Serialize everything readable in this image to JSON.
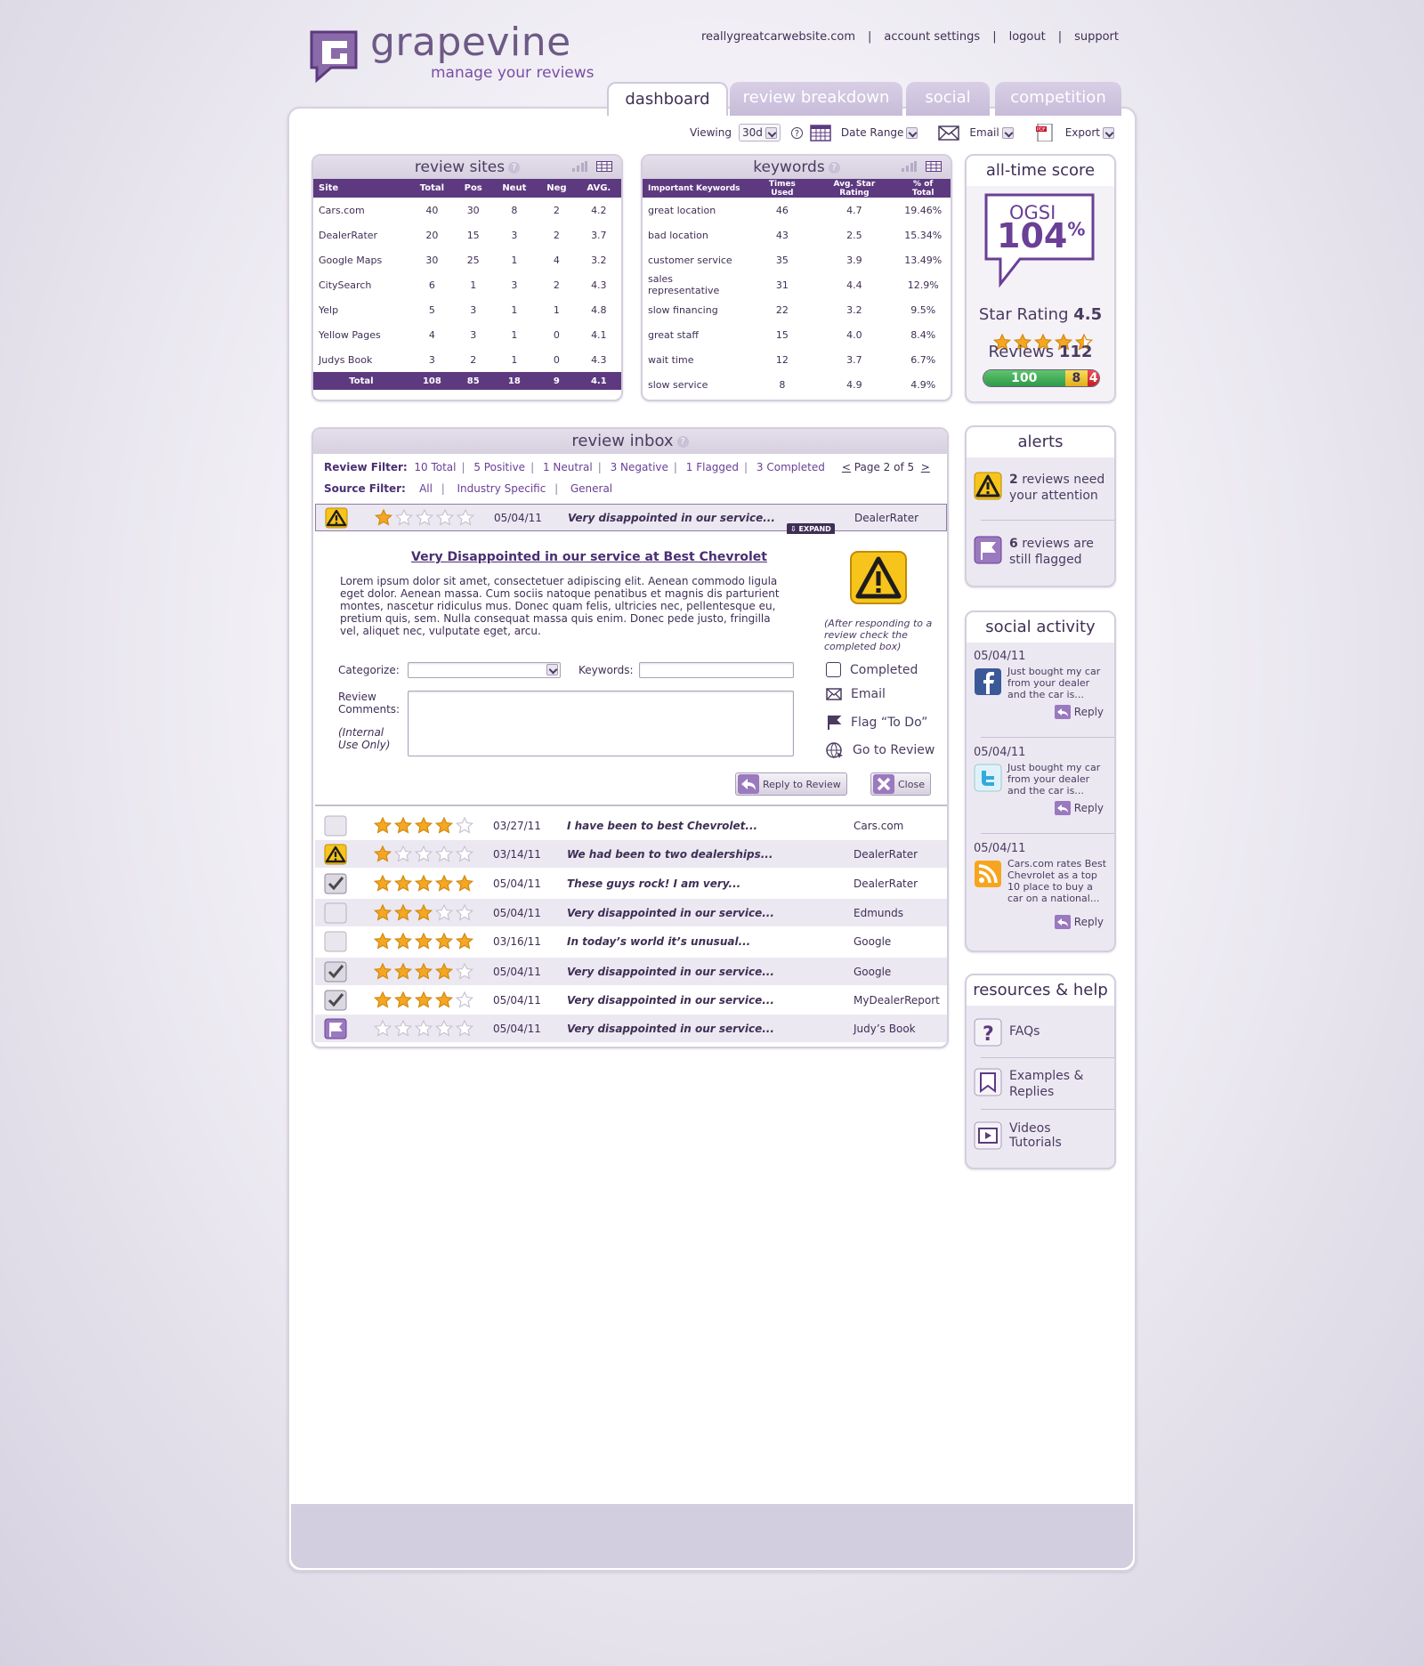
{
  "brand": {
    "name": "grapevine",
    "tagline": "manage your reviews"
  },
  "top_links": [
    "reallygreatcarwebsite.com",
    "account settings",
    "logout",
    "support"
  ],
  "tabs": [
    {
      "label": "dashboard",
      "active": true
    },
    {
      "label": "review breakdown",
      "active": false
    },
    {
      "label": "social",
      "active": false
    },
    {
      "label": "competition",
      "active": false
    }
  ],
  "toolbar": {
    "viewing_label": "Viewing",
    "viewing_value": "30d",
    "date_range": "Date Range",
    "email": "Email",
    "export": "Export"
  },
  "review_sites": {
    "title": "review sites",
    "columns": [
      "Site",
      "Total",
      "Pos",
      "Neut",
      "Neg",
      "AVG."
    ],
    "rows": [
      [
        "Cars.com",
        "40",
        "30",
        "8",
        "2",
        "4.2"
      ],
      [
        "DealerRater",
        "20",
        "15",
        "3",
        "2",
        "3.7"
      ],
      [
        "Google Maps",
        "30",
        "25",
        "1",
        "4",
        "3.2"
      ],
      [
        "CitySearch",
        "6",
        "1",
        "3",
        "2",
        "4.3"
      ],
      [
        "Yelp",
        "5",
        "3",
        "1",
        "1",
        "4.8"
      ],
      [
        "Yellow Pages",
        "4",
        "3",
        "1",
        "0",
        "4.1"
      ],
      [
        "Judys Book",
        "3",
        "2",
        "1",
        "0",
        "4.3"
      ]
    ],
    "total": [
      "Total",
      "108",
      "85",
      "18",
      "9",
      "4.1"
    ]
  },
  "keywords": {
    "title": "keywords",
    "columns": [
      "Important Keywords",
      "Times Used",
      "Avg. Star Rating",
      "% of Total"
    ],
    "rows": [
      [
        "great location",
        "46",
        "4.7",
        "19.46%"
      ],
      [
        "bad location",
        "43",
        "2.5",
        "15.34%"
      ],
      [
        "customer service",
        "35",
        "3.9",
        "13.49%"
      ],
      [
        "sales representative",
        "31",
        "4.4",
        "12.9%"
      ],
      [
        "slow financing",
        "22",
        "3.2",
        "9.5%"
      ],
      [
        "great staff",
        "15",
        "4.0",
        "8.4%"
      ],
      [
        "wait time",
        "12",
        "3.7",
        "6.7%"
      ],
      [
        "slow service",
        "8",
        "4.9",
        "4.9%"
      ]
    ]
  },
  "all_time_score": {
    "title": "all-time score",
    "ogsi_label": "OGSI",
    "ogsi_value": "104",
    "ogsi_unit": "%",
    "star_rating_label": "Star Rating",
    "star_rating_value": "4.5",
    "star_rating": 4.5,
    "reviews_label": "Reviews",
    "reviews_value": "112",
    "breakdown": [
      {
        "value": "100",
        "color": "#2f9a4a"
      },
      {
        "value": "8",
        "color": "#f0c419"
      },
      {
        "value": "4",
        "color": "#d4232a"
      }
    ]
  },
  "alerts": {
    "title": "alerts",
    "items": [
      {
        "count": "2",
        "text": "reviews need your attention"
      },
      {
        "count": "6",
        "text": "reviews are still flagged"
      }
    ]
  },
  "social_activity": {
    "title": "social activity",
    "reply_label": "Reply",
    "items": [
      {
        "date": "05/04/11",
        "icon": "facebook-icon",
        "text": "Just bought my car from your dealer and the car is..."
      },
      {
        "date": "05/04/11",
        "icon": "twitter-icon",
        "text": "Just bought my car from your dealer and the car is..."
      },
      {
        "date": "05/04/11",
        "icon": "rss-icon",
        "text": "Cars.com rates Best Chevrolet as a top 10 place to buy a car on a national..."
      }
    ]
  },
  "resources": {
    "title": "resources & help",
    "items": [
      "FAQs",
      "Examples & Replies",
      "Videos Tutorials"
    ]
  },
  "inbox": {
    "title": "review inbox",
    "review_filter_label": "Review Filter:",
    "review_filters": [
      "10 Total",
      "5 Positive",
      "1 Neutral",
      "3 Negative",
      "1 Flagged",
      "3 Completed"
    ],
    "pager_prev": "<",
    "pager_text": "Page 2 of 5",
    "pager_next": ">",
    "source_filter_label": "Source Filter:",
    "source_filters": [
      "All",
      "Industry Specific",
      "General"
    ],
    "expand_label": "EXPAND",
    "expanded": {
      "date": "05/04/11",
      "snippet": "Very disappointed in our service...",
      "source": "DealerRater",
      "stars": 1,
      "title": "Very Disappointed in our service at Best Chevrolet",
      "body": "Lorem ipsum dolor sit amet, consectetuer adipiscing elit. Aenean commodo ligula eget dolor. Aenean massa. Cum sociis natoque penatibus et magnis dis parturient montes, nascetur ridiculus mus. Donec quam felis, ultricies nec, pellentesque eu, pretium quis, sem. Nulla consequat massa quis enim. Donec pede justo, fringilla vel, aliquet nec, vulputate eget, arcu.",
      "note": "(After responding to a review check the completed box)",
      "categorize_label": "Categorize:",
      "keywords_label": "Keywords:",
      "comments_label": "Review Comments:",
      "internal_label": "(Internal Use Only)",
      "actions": [
        "Completed",
        "Email",
        "Flag “To Do”",
        "Go to Review"
      ],
      "reply_button": "Reply to Review",
      "close_button": "Close"
    },
    "rows": [
      {
        "status": "empty",
        "stars": 4,
        "date": "03/27/11",
        "snippet": "I have been to best Chevrolet...",
        "source": "Cars.com"
      },
      {
        "status": "warning",
        "stars": 1,
        "date": "03/14/11",
        "snippet": "We had been to two dealerships...",
        "source": "DealerRater"
      },
      {
        "status": "checked",
        "stars": 5,
        "date": "05/04/11",
        "snippet": "These guys rock! I am very...",
        "source": "DealerRater"
      },
      {
        "status": "empty",
        "stars": 3,
        "date": "05/04/11",
        "snippet": "Very disappointed in our service...",
        "source": "Edmunds"
      },
      {
        "status": "empty",
        "stars": 5,
        "date": "03/16/11",
        "snippet": "In today’s world it’s unusual...",
        "source": "Google"
      },
      {
        "status": "checked",
        "stars": 4,
        "date": "05/04/11",
        "snippet": "Very disappointed in our service...",
        "source": "Google"
      },
      {
        "status": "checked",
        "stars": 4,
        "date": "05/04/11",
        "snippet": "Very disappointed in our service...",
        "source": "MyDealerReport"
      },
      {
        "status": "flag",
        "stars": 0,
        "date": "05/04/11",
        "snippet": "Very disappointed in our service...",
        "source": "Judy’s Book"
      }
    ]
  },
  "colors": {
    "brand_purple": "#5d3a80",
    "light_purple": "#ece8f2",
    "star_gold": "#f5a623"
  }
}
